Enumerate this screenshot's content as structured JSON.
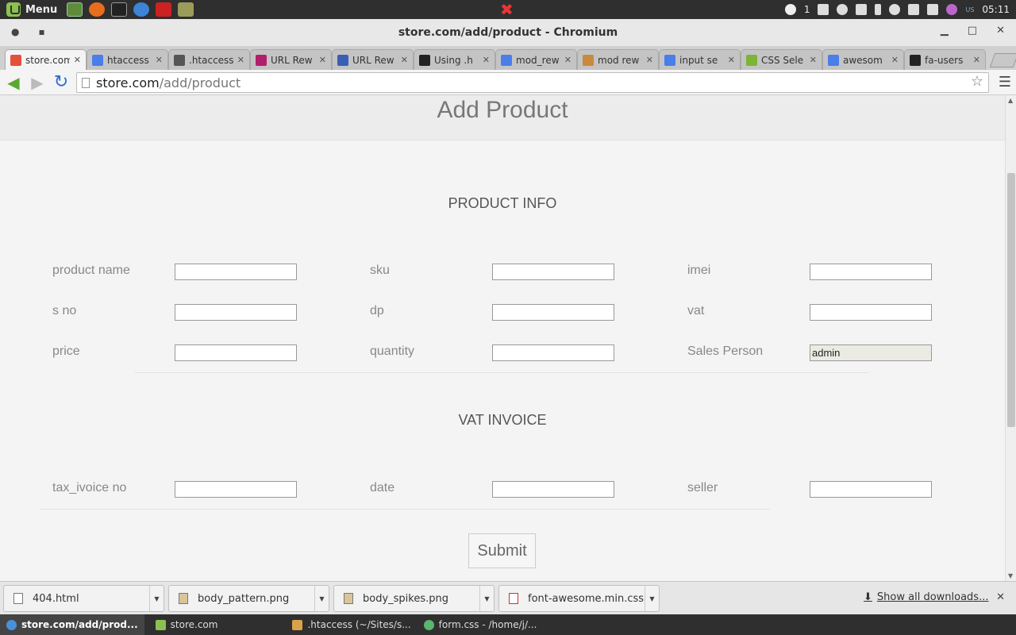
{
  "system_panel": {
    "menu_label": "Menu",
    "notification_count": "1",
    "keyboard_layout": "US",
    "clock": "05:11"
  },
  "window": {
    "title": "store.com/add/product - Chromium"
  },
  "tabs": [
    {
      "label": "store.com",
      "active": true,
      "favicon_color": "#e5503b"
    },
    {
      "label": "htaccess",
      "active": false,
      "favicon_color": "#4a7ee8"
    },
    {
      "label": ".htaccess",
      "active": false,
      "favicon_color": "#555555"
    },
    {
      "label": "URL Rew",
      "active": false,
      "favicon_color": "#b0206a"
    },
    {
      "label": "URL Rew",
      "active": false,
      "favicon_color": "#3a5fb5"
    },
    {
      "label": "Using .h",
      "active": false,
      "favicon_color": "#222222"
    },
    {
      "label": "mod_rew",
      "active": false,
      "favicon_color": "#4a7ee8"
    },
    {
      "label": "mod rew",
      "active": false,
      "favicon_color": "#c98a3e"
    },
    {
      "label": "input se",
      "active": false,
      "favicon_color": "#4a7ee8"
    },
    {
      "label": "CSS Sele",
      "active": false,
      "favicon_color": "#7ab536"
    },
    {
      "label": "awesom",
      "active": false,
      "favicon_color": "#4a7ee8"
    },
    {
      "label": "fa-users",
      "active": false,
      "favicon_color": "#222222"
    }
  ],
  "address_bar": {
    "host": "store.com",
    "path": "/add/product"
  },
  "page": {
    "title": "Add Product",
    "product_info": {
      "heading": "PRODUCT INFO",
      "fields": [
        {
          "label": "product name",
          "value": ""
        },
        {
          "label": "sku",
          "value": ""
        },
        {
          "label": "imei",
          "value": ""
        },
        {
          "label": "s no",
          "value": ""
        },
        {
          "label": "dp",
          "value": ""
        },
        {
          "label": "vat",
          "value": ""
        },
        {
          "label": "price",
          "value": ""
        },
        {
          "label": "quantity",
          "value": ""
        },
        {
          "label": "Sales Person",
          "value": "admin",
          "readonly": true
        }
      ]
    },
    "vat_invoice": {
      "heading": "VAT INVOICE",
      "fields": [
        {
          "label": "tax_ivoice no",
          "value": ""
        },
        {
          "label": "date",
          "value": ""
        },
        {
          "label": "seller",
          "value": ""
        }
      ]
    },
    "submit_label": "Submit"
  },
  "downloads": {
    "items": [
      {
        "name": "404.html"
      },
      {
        "name": "body_pattern.png"
      },
      {
        "name": "body_spikes.png"
      },
      {
        "name": "font-awesome.min.css"
      }
    ],
    "show_all_label": "Show all downloads..."
  },
  "taskbar": {
    "items": [
      {
        "label": "store.com/add/prod...",
        "active": true,
        "icon_color": "#4a90d9"
      },
      {
        "label": "store.com",
        "active": false,
        "icon_color": "#8cc152"
      },
      {
        "label": ".htaccess (~/Sites/s...",
        "active": false,
        "icon_color": "#d9a24a"
      },
      {
        "label": "form.css - /home/j/...",
        "active": false,
        "icon_color": "#5bb56b"
      }
    ]
  }
}
